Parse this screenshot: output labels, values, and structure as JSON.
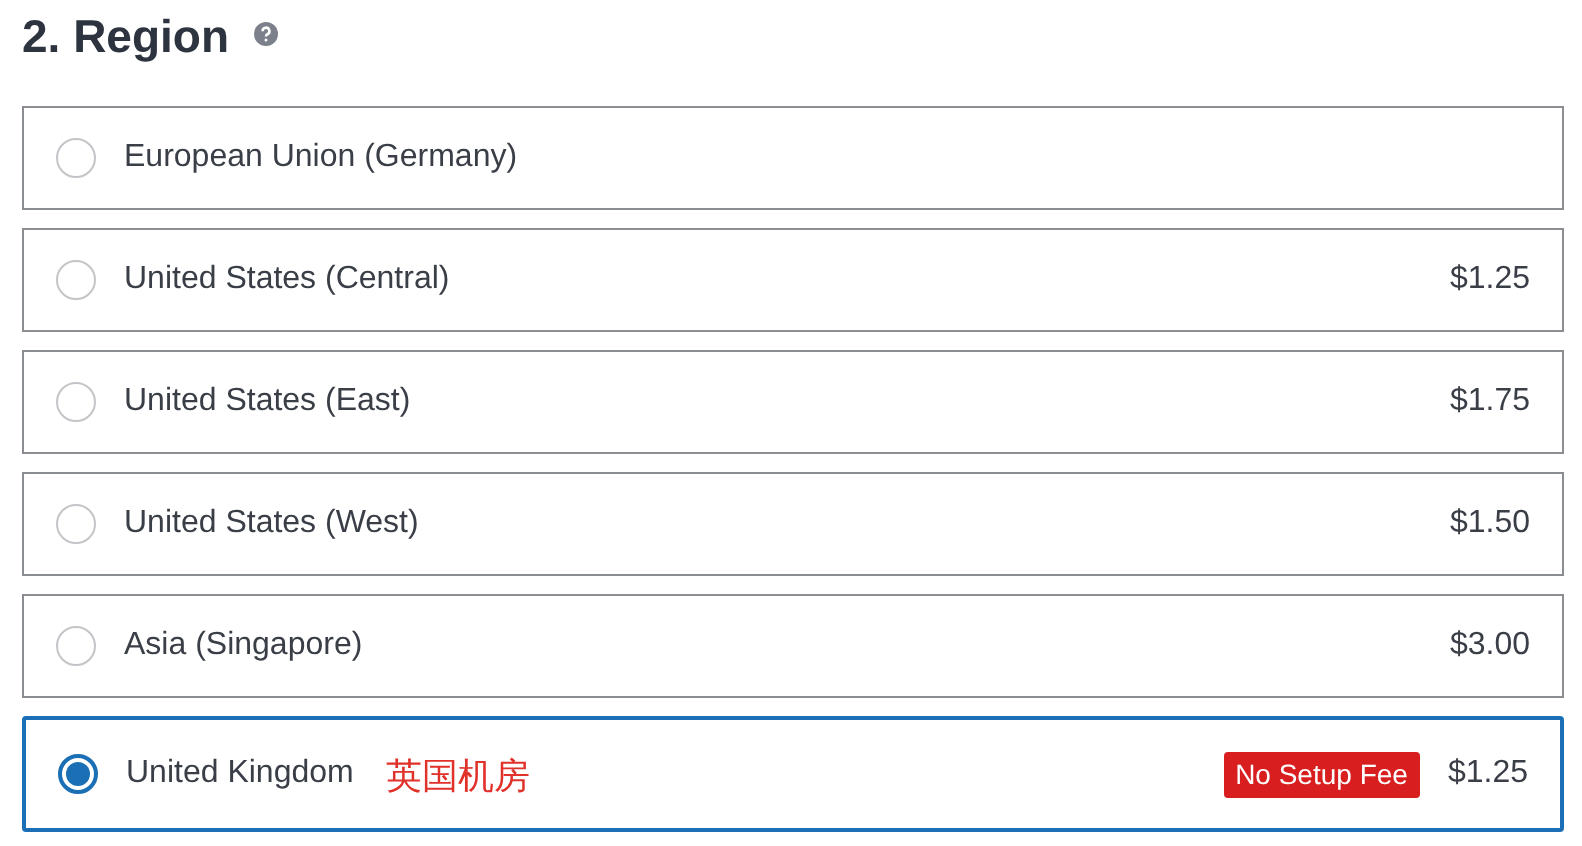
{
  "title": "2. Region",
  "options": [
    {
      "label": "European Union (Germany)",
      "selected": false
    },
    {
      "label": "United States (Central)",
      "price": "$1.25",
      "selected": false
    },
    {
      "label": "United States (East)",
      "price": "$1.75",
      "selected": false
    },
    {
      "label": "United States (West)",
      "price": "$1.50",
      "selected": false
    },
    {
      "label": "Asia (Singapore)",
      "price": "$3.00",
      "selected": false
    },
    {
      "label": "United Kingdom",
      "note": "英国机房",
      "badge": "No Setup Fee",
      "price": "$1.25",
      "selected": true
    }
  ]
}
